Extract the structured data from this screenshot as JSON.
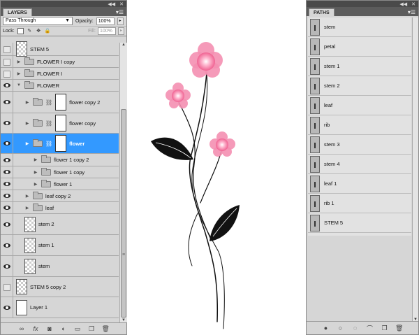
{
  "layers_panel": {
    "tab_label": "LAYERS",
    "blend_mode": "Pass Through",
    "opacity_label": "Opacity:",
    "opacity_value": "100%",
    "lock_label": "Lock:",
    "fill_label": "Fill:",
    "fill_value": "100%",
    "layers": [
      {
        "name": "STEM 5",
        "visible": false,
        "kind": "layer",
        "indent": 0
      },
      {
        "name": "FLOWER I copy",
        "visible": false,
        "kind": "group",
        "indent": 0
      },
      {
        "name": "FLOWER I",
        "visible": false,
        "kind": "group",
        "indent": 0
      },
      {
        "name": "FLOWER",
        "visible": true,
        "kind": "group-open",
        "indent": 0
      },
      {
        "name": "flower copy 2",
        "visible": true,
        "kind": "masked-group",
        "indent": 1
      },
      {
        "name": "flower copy",
        "visible": true,
        "kind": "masked-group",
        "indent": 1
      },
      {
        "name": "flower",
        "visible": true,
        "kind": "masked-group",
        "indent": 1,
        "selected": true
      },
      {
        "name": "flower 1 copy 2",
        "visible": true,
        "kind": "group",
        "indent": 2
      },
      {
        "name": "flower 1 copy",
        "visible": true,
        "kind": "group",
        "indent": 2
      },
      {
        "name": "flower 1",
        "visible": true,
        "kind": "group",
        "indent": 2
      },
      {
        "name": "leaf copy 2",
        "visible": true,
        "kind": "group",
        "indent": 1
      },
      {
        "name": "leaf",
        "visible": true,
        "kind": "group",
        "indent": 1
      },
      {
        "name": "stem 2",
        "visible": true,
        "kind": "layer",
        "indent": 1
      },
      {
        "name": "stem 1",
        "visible": true,
        "kind": "layer",
        "indent": 1
      },
      {
        "name": "stem",
        "visible": true,
        "kind": "layer",
        "indent": 1
      },
      {
        "name": "STEM 5 copy 2",
        "visible": false,
        "kind": "layer",
        "indent": 0
      },
      {
        "name": "Layer 1",
        "visible": true,
        "kind": "white",
        "indent": 0
      }
    ],
    "footer_icons": [
      "link-icon",
      "fx-icon",
      "mask-icon",
      "adjustment-icon",
      "group-icon",
      "new-layer-icon",
      "trash-icon"
    ]
  },
  "paths_panel": {
    "tab_label": "PATHS",
    "paths": [
      "stem",
      "petal",
      "stem 1",
      "stem 2",
      "leaf",
      "rib",
      "stem 3",
      "stem 4",
      "leaf 1",
      "rib 1",
      "STEM 5"
    ],
    "footer_icons": [
      "fill-path-icon",
      "stroke-path-icon",
      "load-selection-icon",
      "make-path-icon",
      "new-path-icon",
      "trash-icon"
    ]
  },
  "colors": {
    "selection": "#3399ff",
    "petal": "#f06292",
    "petal_light": "#ffc1d6",
    "panel_bg": "#d6d6d6"
  }
}
